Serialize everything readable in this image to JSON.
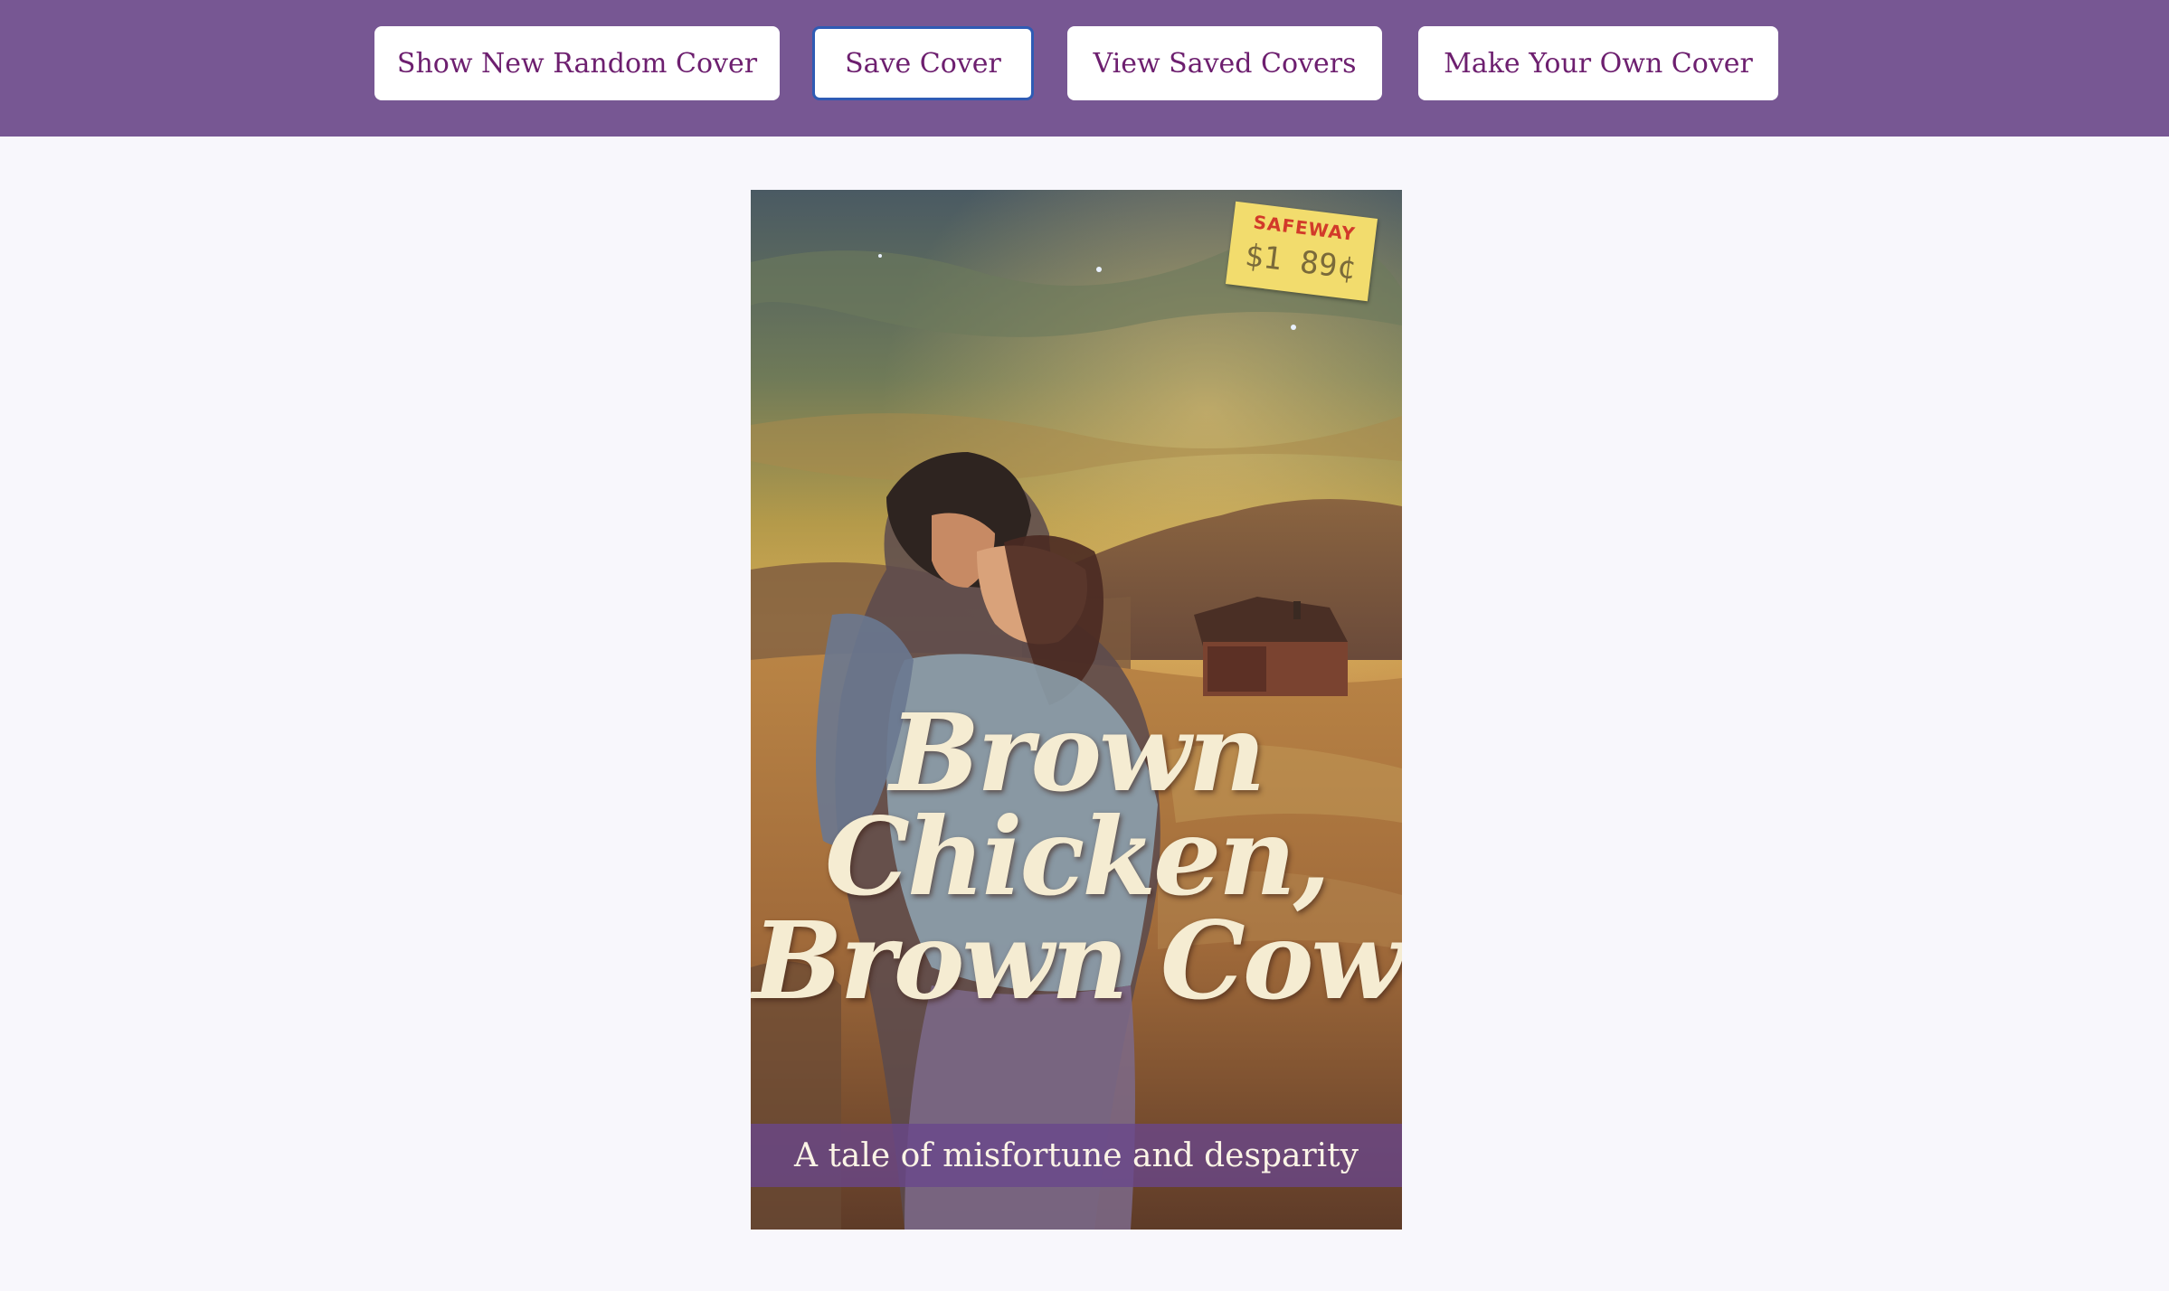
{
  "toolbar": {
    "random_label": "Show New Random Cover",
    "save_label": "Save Cover",
    "view_label": "View Saved Covers",
    "make_label": "Make Your Own Cover"
  },
  "cover": {
    "title_line1": "Brown",
    "title_line2": "Chicken,",
    "title_line3": "Brown Cow",
    "tagline": "A tale of misfortune and desparity",
    "sticker_store": "SAFEWAY",
    "sticker_price": "$1 89¢"
  },
  "colors": {
    "header_bg": "#775793",
    "button_text": "#6d1f6f",
    "page_bg": "#f8f7fc",
    "focus_ring": "#2f5bb4",
    "title_text": "#f5ecd2"
  }
}
